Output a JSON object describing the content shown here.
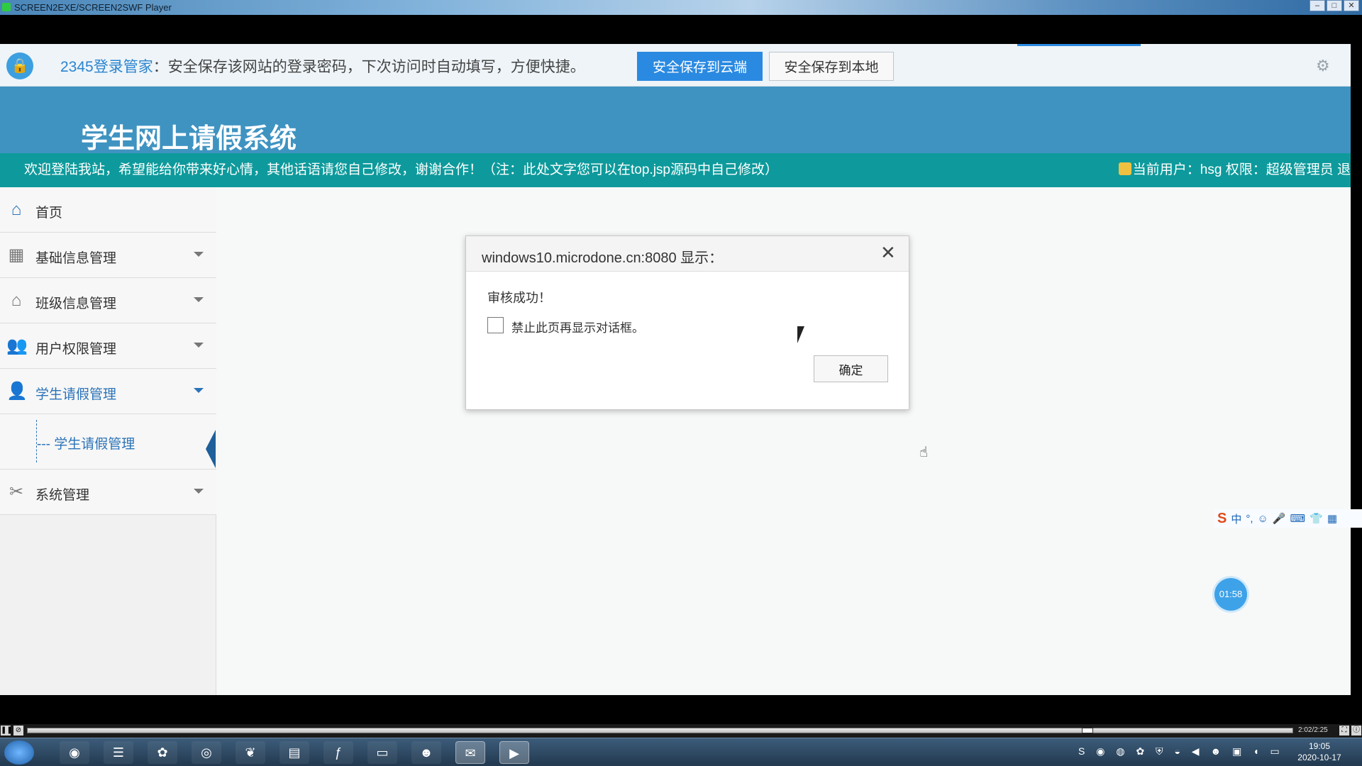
{
  "player": {
    "title": "SCREEN2EXE/SCREEN2SWF Player",
    "time": "2:02/2:25"
  },
  "password_bar": {
    "brand": "2345登录管家",
    "message": "：安全保存该网站的登录密码，下次访问时自动填写，方便快捷。",
    "btn_cloud": "安全保存到云端",
    "btn_local": "安全保存到本地"
  },
  "header": {
    "system_name": "学生网上请假系统",
    "welcome": "欢迎登陆我站，希望能给你带来好心情，其他话语请您自己修改，谢谢合作！（注：此处文字您可以在top.jsp源码中自己修改）",
    "user_info": "当前用户：hsg  权限：超级管理员 退"
  },
  "sidebar": {
    "items": [
      {
        "label": "首页",
        "icon": "home-icon"
      },
      {
        "label": "基础信息管理",
        "icon": "grid-icon"
      },
      {
        "label": "班级信息管理",
        "icon": "house-icon"
      },
      {
        "label": "用户权限管理",
        "icon": "users-icon"
      },
      {
        "label": "学生请假管理",
        "icon": "user-icon"
      },
      {
        "label": "系统管理",
        "icon": "tools-icon"
      }
    ],
    "submenu": {
      "label": "--- 学生请假管理"
    }
  },
  "dialog": {
    "title": "windows10.microdone.cn:8080 显示：",
    "message": "审核成功！",
    "checkbox_label": "禁止此页再显示对话框。",
    "ok": "确定"
  },
  "ime": {
    "items": [
      "中",
      "°,",
      "☺",
      "🎤",
      "⌨",
      "👕",
      "▦"
    ]
  },
  "timer": "01:58",
  "taskbar": {
    "time": "19:05",
    "date": "2020-10-17"
  },
  "colors": {
    "accent": "#2a8ae2",
    "header": "#3f93c1",
    "notice": "#0e9a9c",
    "active": "#2b73b8"
  }
}
